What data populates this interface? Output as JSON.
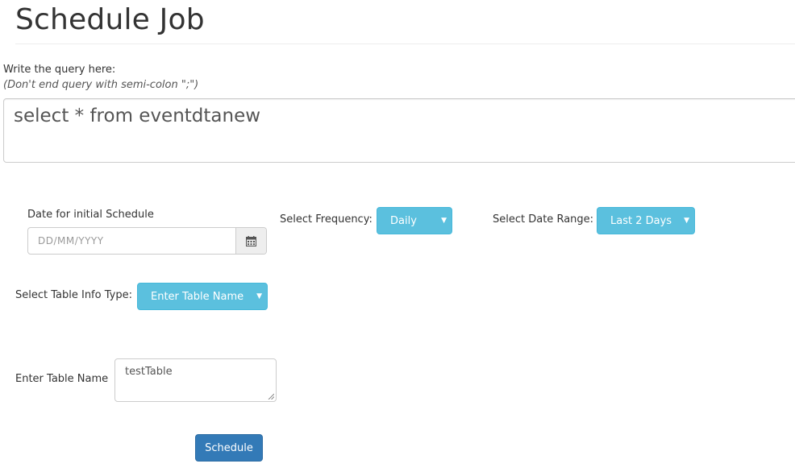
{
  "header": {
    "title": "Schedule Job"
  },
  "query": {
    "label": "Write the query here:",
    "hint": "(Don't end query with semi-colon \";\")",
    "value": "select * from eventdtanew"
  },
  "schedule": {
    "date_label": "Date for initial Schedule",
    "date_placeholder": "DD/MM/YYYY",
    "calendar_icon": "calendar-icon"
  },
  "frequency": {
    "label": "Select Frequency:",
    "selected": "Daily"
  },
  "date_range": {
    "label": "Select Date Range:",
    "selected": "Last 2 Days"
  },
  "table_info": {
    "label": "Select Table Info Type:",
    "selected": "Enter Table Name"
  },
  "table_name": {
    "label": "Enter Table Name",
    "value": "testTable"
  },
  "actions": {
    "schedule_label": "Schedule"
  },
  "colors": {
    "info": "#5bc0de",
    "primary": "#337ab7",
    "border": "#cccccc"
  }
}
